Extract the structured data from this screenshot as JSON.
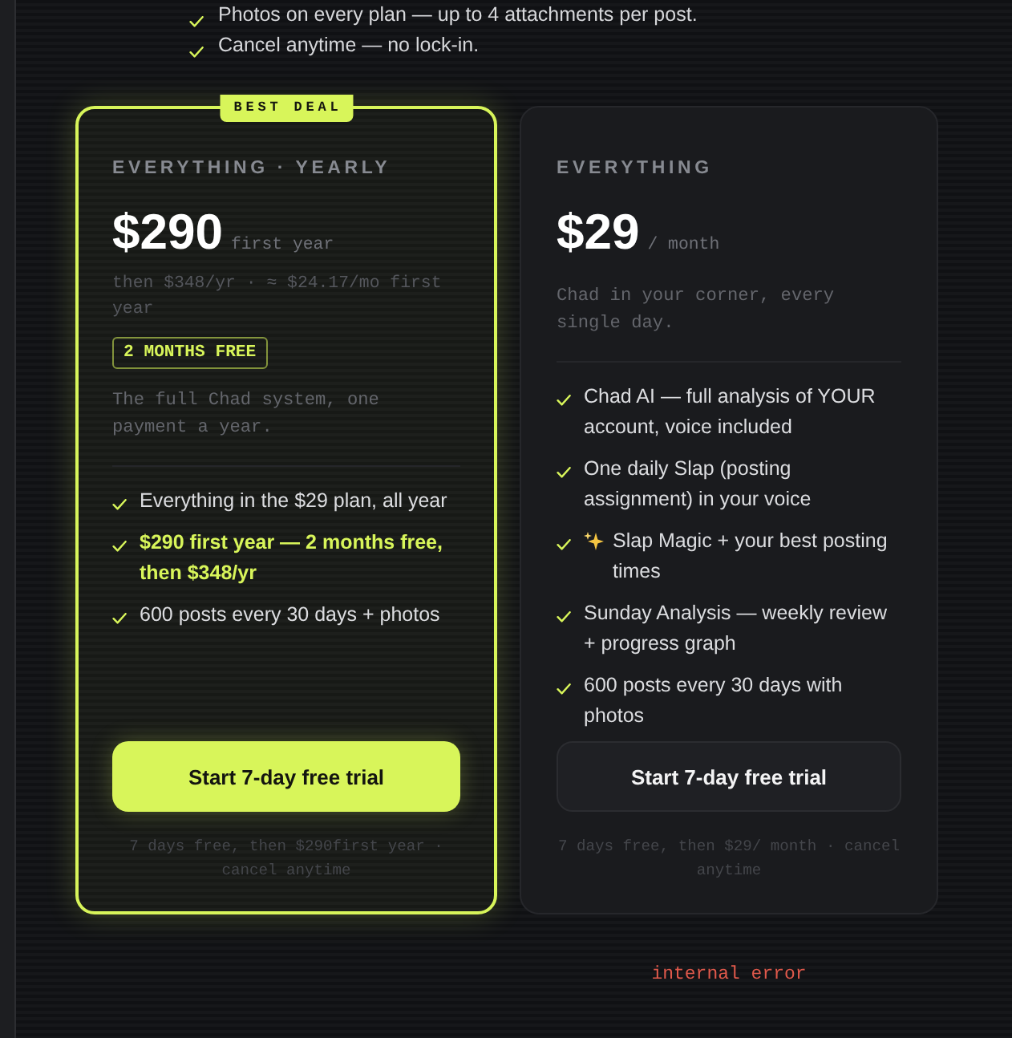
{
  "perks": [
    {
      "text": "Photos on every plan — up to 4 attachments per post."
    },
    {
      "text": "Cancel anytime — no lock-in."
    }
  ],
  "plans": [
    {
      "featured": true,
      "badge": "BEST DEAL",
      "name": "EVERYTHING · YEARLY",
      "price": "$290",
      "period": "first year",
      "note": "then $348/yr · ≈ $24.17/mo first year",
      "tag": "2 MONTHS FREE",
      "description": "The full Chad system, one payment a year.",
      "features": [
        {
          "kind": "plain",
          "text": "Everything in the $29 plan, all year",
          "highlight": false
        },
        {
          "kind": "plain",
          "text": "$290 first year — 2 months free, then $348/yr",
          "highlight": true
        },
        {
          "kind": "plain",
          "text": "600 posts every 30 days + photos",
          "highlight": false
        }
      ],
      "cta": "Start 7-day free trial",
      "footnote": "7 days free, then $290first year · cancel anytime"
    },
    {
      "featured": false,
      "name": "EVERYTHING",
      "price": "$29",
      "period": "/ month",
      "description": "Chad in your corner, every single day.",
      "features": [
        {
          "kind": "plain",
          "text": "Chad AI — full analysis of YOUR account, voice included",
          "highlight": false
        },
        {
          "kind": "plain",
          "text": "One daily Slap (posting assignment) in your voice",
          "highlight": false
        },
        {
          "kind": "sparkle",
          "text": "Slap Magic + your best posting times",
          "highlight": false
        },
        {
          "kind": "plain",
          "text": "Sunday Analysis — weekly review + progress graph",
          "highlight": false
        },
        {
          "kind": "plain",
          "text": "600 posts every 30 days with photos",
          "highlight": false
        }
      ],
      "cta": "Start 7-day free trial",
      "footnote": "7 days free, then $29/ month · cancel anytime"
    }
  ],
  "error": "internal error"
}
